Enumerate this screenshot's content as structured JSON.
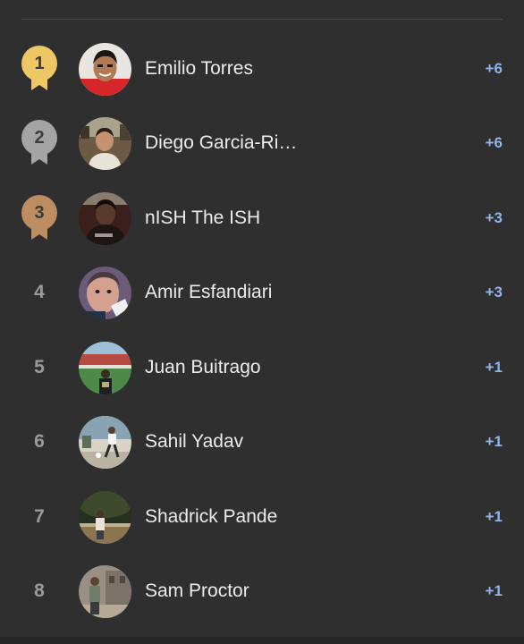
{
  "leaderboard": {
    "rows": [
      {
        "rank": "1",
        "name": "Emilio Torres",
        "score": "+6",
        "medal": "gold",
        "medal_color": "#efc765",
        "avatar_icon": "person-avatar-red-shirt"
      },
      {
        "rank": "2",
        "name": "Diego Garcia-Ri…",
        "score": "+6",
        "medal": "silver",
        "medal_color": "#a4a4a4",
        "avatar_icon": "person-avatar-outdoor"
      },
      {
        "rank": "3",
        "name": "nISH The ISH",
        "score": "+3",
        "medal": "bronze",
        "medal_color": "#bd8c60",
        "avatar_icon": "person-avatar-dark"
      },
      {
        "rank": "4",
        "name": "Amir Esfandiari",
        "score": "+3",
        "medal": "none",
        "avatar_icon": "person-avatar-closeup"
      },
      {
        "rank": "5",
        "name": "Juan Buitrago",
        "score": "+1",
        "medal": "none",
        "avatar_icon": "person-avatar-stadium"
      },
      {
        "rank": "6",
        "name": "Sahil Yadav",
        "score": "+1",
        "medal": "none",
        "avatar_icon": "person-avatar-sport"
      },
      {
        "rank": "7",
        "name": "Shadrick Pande",
        "score": "+1",
        "medal": "none",
        "avatar_icon": "person-avatar-evening"
      },
      {
        "rank": "8",
        "name": "Sam Proctor",
        "score": "+1",
        "medal": "none",
        "avatar_icon": "person-avatar-street"
      }
    ]
  },
  "colors": {
    "background": "#2f2f2f",
    "name_text": "#ececec",
    "score_text": "#8fb4ee",
    "rank_text": "#9a9a9a"
  }
}
